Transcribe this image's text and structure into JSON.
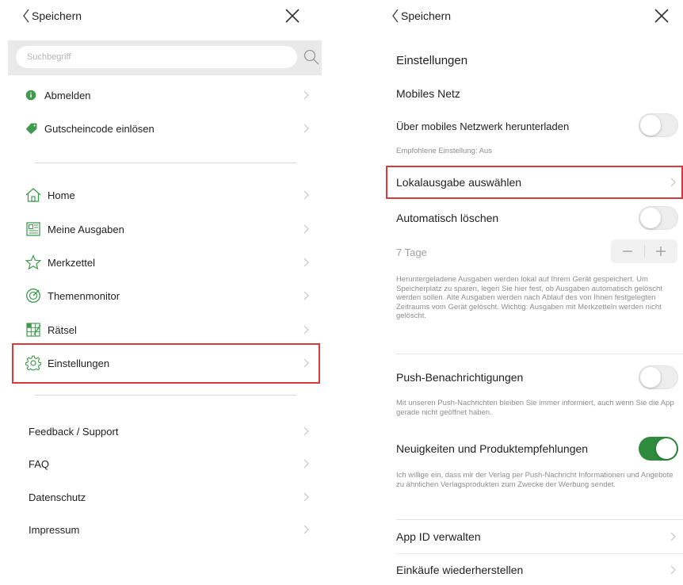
{
  "left": {
    "back_label": "Speichern",
    "search_placeholder": "Suchbegriff",
    "account_items": [
      {
        "label": "Abmelden",
        "icon": "info-circle-icon"
      },
      {
        "label": "Gutscheincode einlösen",
        "icon": "tag-icon"
      }
    ],
    "nav_items": [
      {
        "label": "Home",
        "icon": "home-icon"
      },
      {
        "label": "Meine Ausgaben",
        "icon": "newspaper-icon"
      },
      {
        "label": "Merkzettel",
        "icon": "star-icon"
      },
      {
        "label": "Themenmonitor",
        "icon": "compass-icon"
      },
      {
        "label": "Rätsel",
        "icon": "puzzle-grid-icon"
      },
      {
        "label": "Einstellungen",
        "icon": "gear-icon"
      }
    ],
    "footer_items": [
      {
        "label": "Feedback / Support"
      },
      {
        "label": "FAQ"
      },
      {
        "label": "Datenschutz"
      },
      {
        "label": "Impressum"
      }
    ],
    "highlighted_item": "Einstellungen"
  },
  "right": {
    "back_label": "Speichern",
    "page_title": "Einstellungen",
    "mobile_section_title": "Mobiles Netz",
    "mobile_download_label": "Über mobiles Netzwerk herunterladen",
    "mobile_download_on": false,
    "mobile_download_hint": "Empfohlene Einstellung: Aus",
    "local_edition_label": "Lokalausgabe auswählen",
    "auto_delete_label": "Automatisch löschen",
    "auto_delete_on": false,
    "days_value": "7 Tage",
    "stepper_minus": "−",
    "stepper_plus": "+",
    "auto_delete_desc": "Heruntergeladene Ausgaben werden lokal auf Ihrem Gerät gespeichert. Um Speicherplatz zu sparen, legen Sie hier fest, ob Ausgaben automatisch gelöscht werden sollen. Alte Ausgaben werden nach Ablauf des von Ihnen festgelegten Zeitraums vom Gerät gelöscht. Wichtig: Ausgaben mit Merkzetteln werden nicht gelöscht.",
    "push_label": "Push-Benachrichtigungen",
    "push_on": false,
    "push_desc": "Mit unseren Push-Nachrichten bleiben Sie immer informiert, auch wenn Sie die App gerade nicht geöffnet haben.",
    "news_label": "Neuigkeiten und Produktempfehlungen",
    "news_on": true,
    "news_desc": "Ich willige ein, dass mir der Verlag per Push-Nachricht Informationen und Angebote zu ähnlichen Verlagsprodukten zum Zwecke der Werbung sendet.",
    "app_id_label": "App ID verwalten",
    "restore_label": "Einkäufe wiederherstellen",
    "highlighted_item": "Lokalausgabe auswählen"
  },
  "colors": {
    "accent_green": "#2e8b3e",
    "highlight_red": "#d63a3a",
    "icon_green": "#3f9a4e"
  }
}
